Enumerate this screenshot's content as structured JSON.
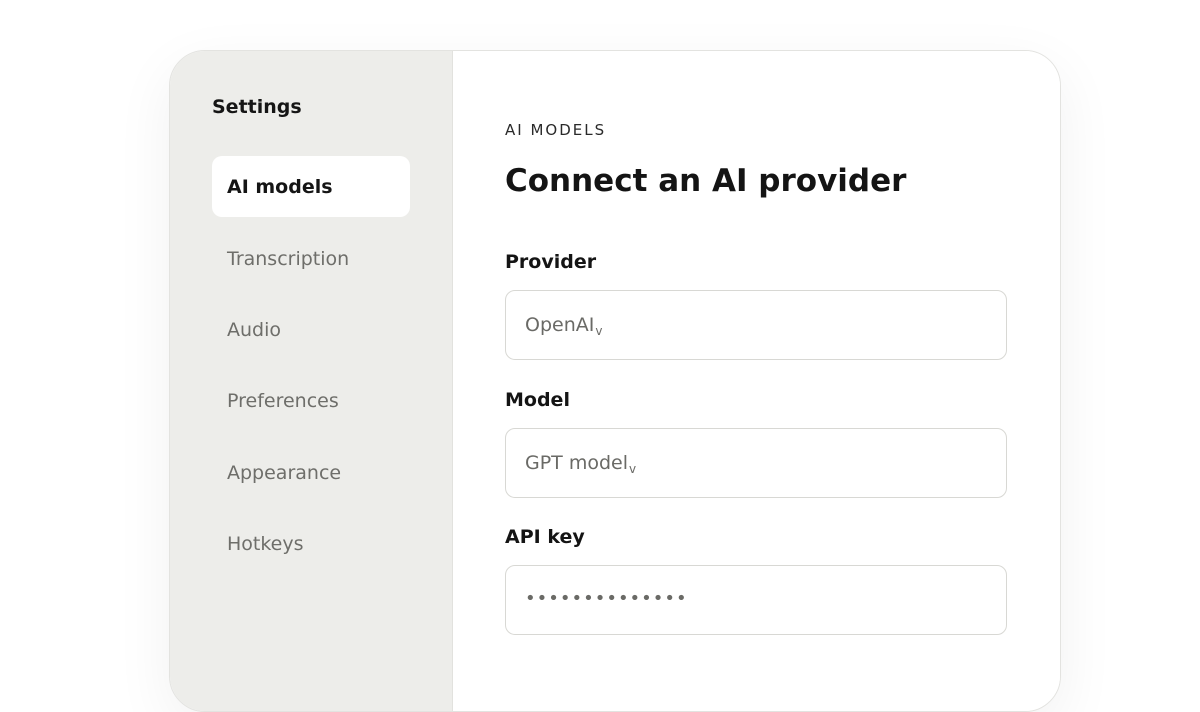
{
  "sidebar": {
    "title": "Settings",
    "items": [
      {
        "label": "AI models",
        "active": true
      },
      {
        "label": "Transcription",
        "active": false
      },
      {
        "label": "Audio",
        "active": false
      },
      {
        "label": "Preferences",
        "active": false
      },
      {
        "label": "Appearance",
        "active": false
      },
      {
        "label": "Hotkeys",
        "active": false
      }
    ]
  },
  "main": {
    "eyebrow": "AI MODELS",
    "heading": "Connect an AI provider",
    "provider": {
      "label": "Provider",
      "value": "OpenAI",
      "caret": "v"
    },
    "model": {
      "label": "Model",
      "value": "GPT model",
      "caret": "v"
    },
    "api_key": {
      "label": "API key",
      "value": "••••••••••••••"
    }
  },
  "colors": {
    "sidebar_bg": "#ededea",
    "active_item_bg": "#ffffff",
    "text_primary": "#151515",
    "text_muted": "#6e6e6a",
    "border": "#d8d8d4"
  }
}
